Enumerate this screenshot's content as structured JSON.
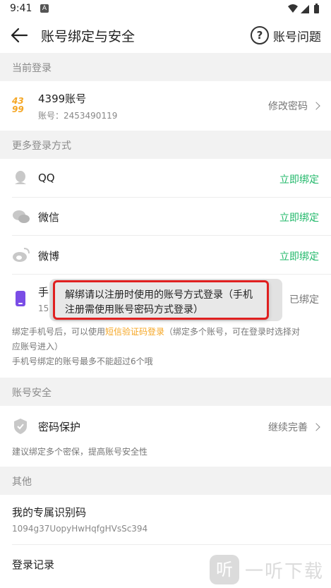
{
  "status_bar": {
    "time": "9:41",
    "notification_badge": "A"
  },
  "header": {
    "title": "账号绑定与安全",
    "help_label": "账号问题"
  },
  "sections": {
    "current_login": "当前登录",
    "more_login": "更多登录方式",
    "account_security": "账号安全",
    "other": "其他"
  },
  "current_account": {
    "logo_text_top": "43",
    "logo_text_bottom": "99",
    "title": "4399账号",
    "account_label": "账号：2453490119",
    "action": "修改密码"
  },
  "bindings": {
    "qq": {
      "label": "QQ",
      "action": "立即绑定"
    },
    "wechat": {
      "label": "微信",
      "action": "立即绑定"
    },
    "weibo": {
      "label": "微博",
      "action": "立即绑定"
    },
    "phone": {
      "label_visible": "手",
      "number_visible": "15",
      "action": "已绑定"
    }
  },
  "phone_note": {
    "line1_prefix": "绑定手机号后，可以使用",
    "line1_highlight": "短信验证码登录",
    "line1_suffix": "（绑定多个账号，可在登录时选择对",
    "line2": "应账号进入）",
    "line3": "手机号绑定的账号最多不能超过6个哦"
  },
  "security": {
    "title": "密码保护",
    "action": "继续完善",
    "note": "建议绑定多个密保，提高账号安全性"
  },
  "other": {
    "id_title": "我的专属识别码",
    "id_value": "1094g37UopyHwHqfgHVsSc394",
    "login_record": "登录记录"
  },
  "toast": {
    "line1": "解绑请以注册时使用的账号方式登录（手机",
    "line2": "注册需使用账号密码方式登录）"
  },
  "watermark": {
    "text": "一听下载"
  },
  "colors": {
    "accent_green": "#21b86a",
    "highlight_orange": "#f5a623",
    "toast_border": "#e02020"
  }
}
